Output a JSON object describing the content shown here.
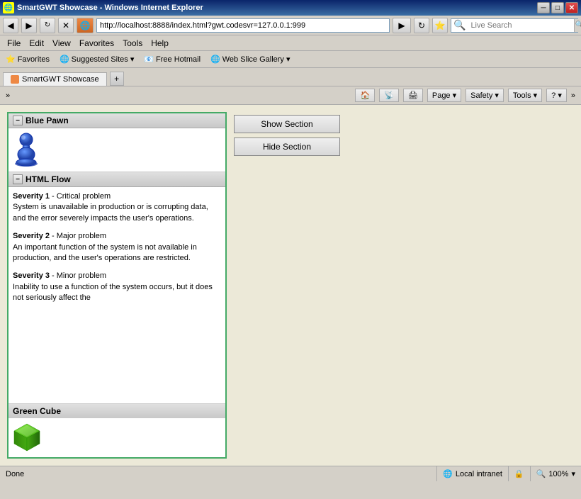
{
  "window": {
    "title": "SmartGWT Showcase - Windows Internet Explorer",
    "icon": "ie-icon"
  },
  "titlebar": {
    "minimize": "─",
    "maximize": "□",
    "close": "✕"
  },
  "address_bar": {
    "url": "http://localhost:8888/index.html?gwt.codesvr=127.0.0.1:999",
    "search_placeholder": "Live Search"
  },
  "menu": {
    "items": [
      "File",
      "Edit",
      "View",
      "Favorites",
      "Tools",
      "Help"
    ]
  },
  "favorites_bar": {
    "favorites_label": "Favorites",
    "items": [
      "Suggested Sites ▾",
      "Free Hotmail",
      "Web Slice Gallery ▾"
    ]
  },
  "tab": {
    "label": "SmartGWT Showcase"
  },
  "nav_row": {
    "buttons": [
      "Page ▾",
      "Safety ▾",
      "Tools ▾",
      "?▾"
    ],
    "extra": "»"
  },
  "sections": {
    "blue_pawn": {
      "header": "Blue Pawn",
      "toggle": "−"
    },
    "html_flow": {
      "header": "HTML Flow",
      "toggle": "−",
      "severities": [
        {
          "label": "Severity 1",
          "title": "Critical problem",
          "description": "System is unavailable in production or is corrupting data, and the error severely impacts the user's operations."
        },
        {
          "label": "Severity 2",
          "title": "Major problem",
          "description": "An important function of the system is not available in production, and the user's operations are restricted."
        },
        {
          "label": "Severity 3",
          "title": "Minor problem",
          "description": "Inability to use a function of the system occurs, but it does not seriously affect the"
        }
      ]
    },
    "green_cube": {
      "header": "Green Cube"
    }
  },
  "buttons": {
    "show_section": "Show Section",
    "hide_section": "Hide Section"
  },
  "status_bar": {
    "status": "Done",
    "zone": "Local intranet",
    "zoom": "100%"
  }
}
